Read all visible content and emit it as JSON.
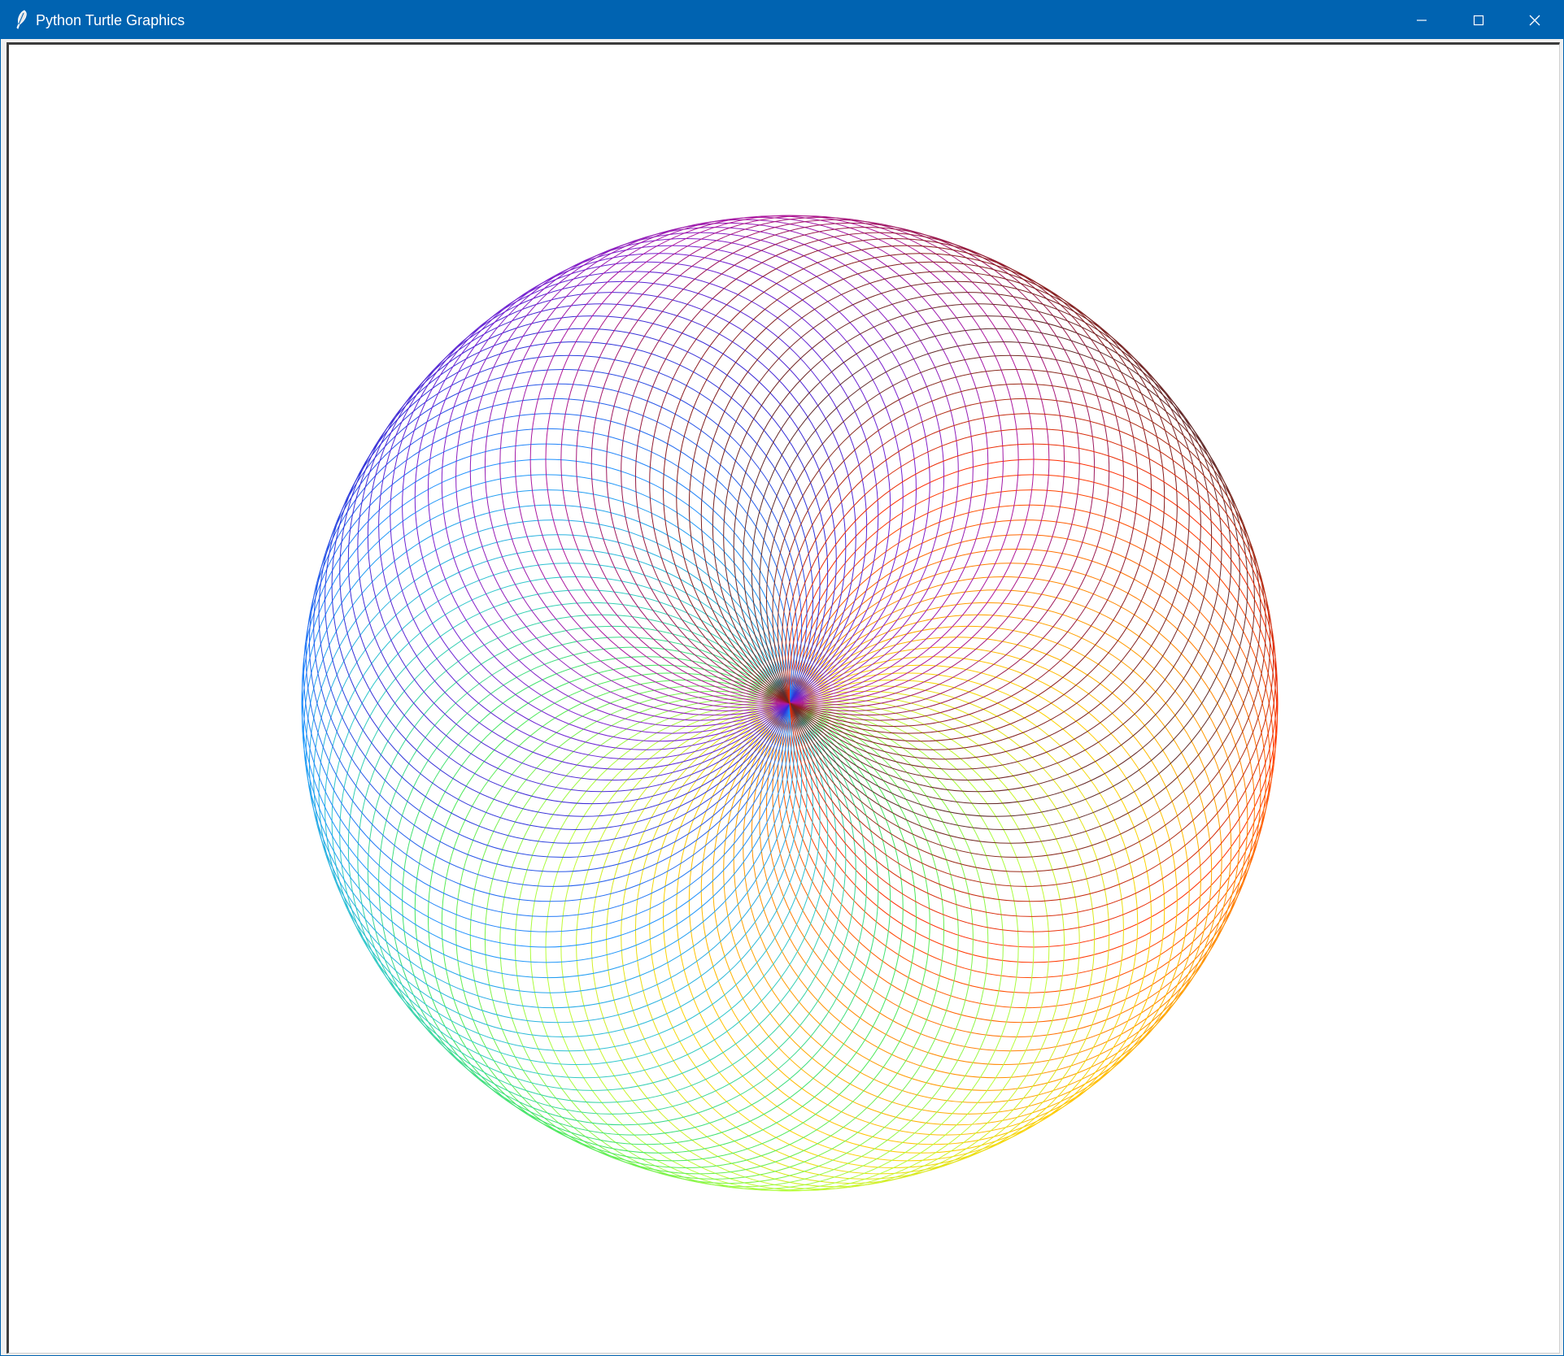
{
  "window": {
    "title": "Python Turtle Graphics",
    "controls": {
      "minimize": "minimize",
      "maximize": "maximize",
      "close": "close"
    },
    "titlebar_color": "#0063b1"
  },
  "canvas": {
    "background": "#ffffff",
    "pattern": "spirograph-rainbow-circles",
    "circle_count": 100,
    "palette": [
      "#ff2d00",
      "#ff8c00",
      "#ffd000",
      "#b8ff3a",
      "#46e85a",
      "#30c9c9",
      "#1e90ff",
      "#2f2fd8",
      "#7a1fd0",
      "#b0179a",
      "#8b1a1a",
      "#5a2a2a"
    ]
  }
}
